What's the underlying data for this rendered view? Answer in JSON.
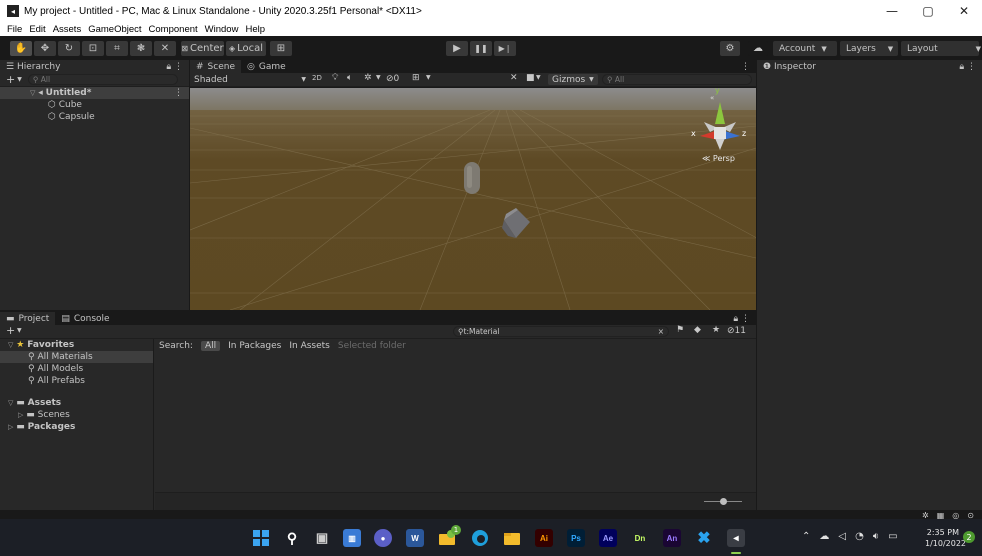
{
  "window": {
    "title": "My project - Untitled - PC, Mac & Linux Standalone - Unity 2020.3.25f1 Personal* <DX11>",
    "minimize": "—",
    "maximize": "▢",
    "close": "✕"
  },
  "menu": [
    "File",
    "Edit",
    "Assets",
    "GameObject",
    "Component",
    "Window",
    "Help"
  ],
  "toolbar": {
    "center_label": "Center",
    "local_label": "Local",
    "account_label": "Account",
    "layers_label": "Layers",
    "layout_label": "Layout"
  },
  "hierarchy": {
    "tab_label": "Hierarchy",
    "add_label": "+",
    "search_placeholder": "All",
    "scene_name": "Untitled*",
    "items": [
      "Cube",
      "Capsule"
    ]
  },
  "scene": {
    "tab_scene": "Scene",
    "tab_game": "Game",
    "draw_mode": "Shaded",
    "mode_2d": "2D",
    "hidden_count": "0",
    "gizmos_label": "Gizmos",
    "search_placeholder": "All",
    "persp_label": "Persp",
    "axis_y": "y",
    "axis_x": "x",
    "axis_z": "z"
  },
  "inspector": {
    "tab_label": "Inspector"
  },
  "project": {
    "tab_project": "Project",
    "tab_console": "Console",
    "add_label": "+",
    "search_value": "t:Material",
    "hidden_count": "11",
    "favorites_label": "Favorites",
    "favorites": [
      "All Materials",
      "All Models",
      "All Prefabs"
    ],
    "assets_label": "Assets",
    "assets_children": [
      "Scenes"
    ],
    "packages_label": "Packages",
    "search_scope_label": "Search:",
    "scopes": [
      "All",
      "In Packages",
      "In Assets",
      "Selected folder"
    ]
  },
  "taskbar": {
    "apps": [
      "Ai",
      "Ps",
      "Ae",
      "Dn",
      "An"
    ],
    "word_label": "W",
    "time": "2:35 PM",
    "date": "1/10/2022",
    "notification_count": "2",
    "badge_count": "1"
  },
  "colors": {
    "accent_blue": "#3a72b0",
    "ground": "#5e4a25",
    "sky_top": "#8d8d8d"
  }
}
